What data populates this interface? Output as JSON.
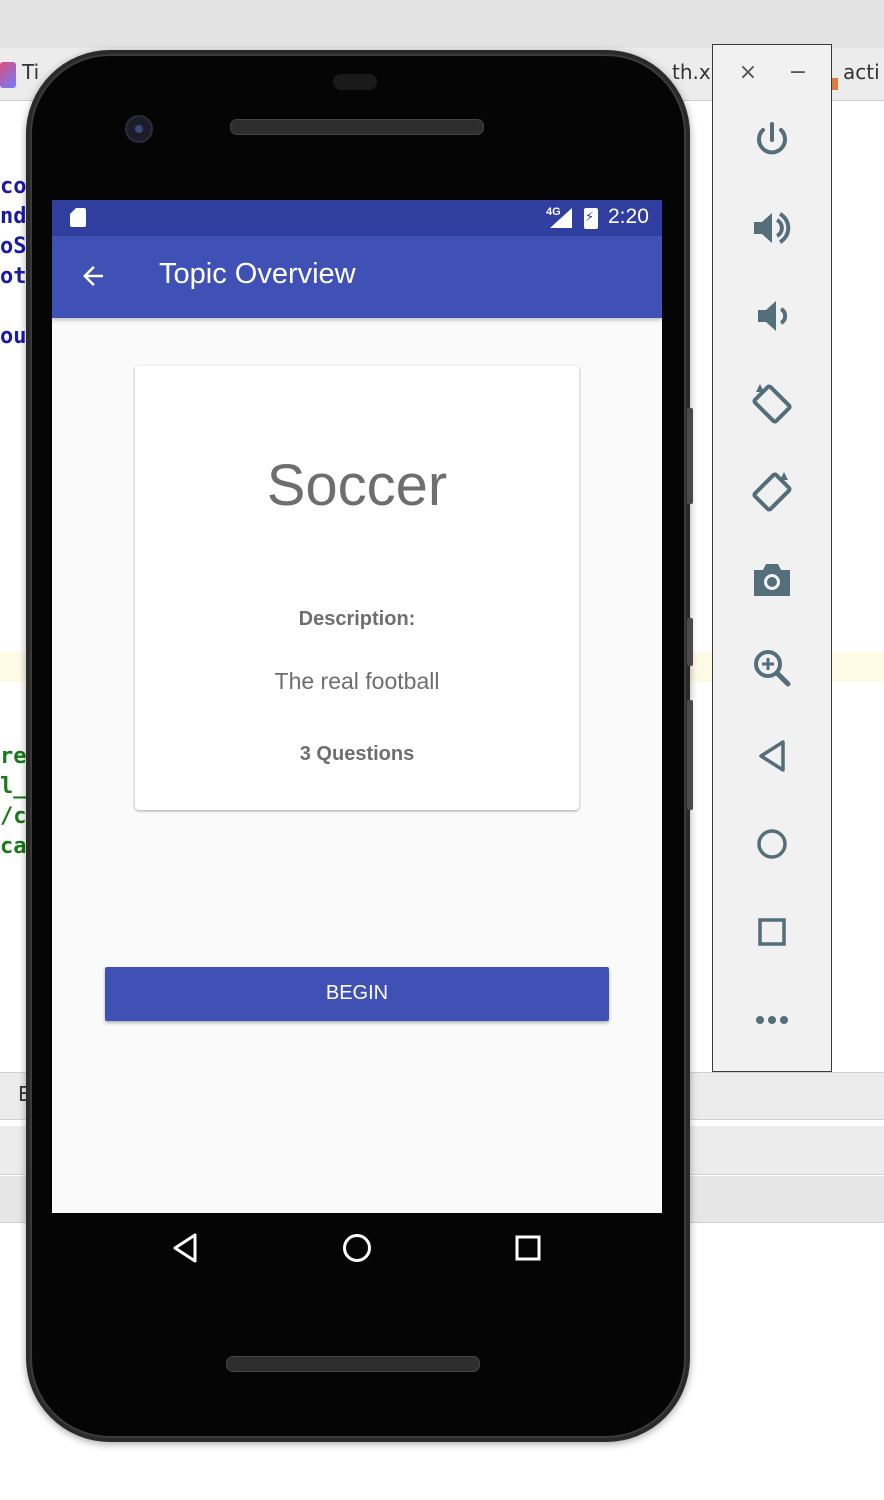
{
  "ide": {
    "tab_left": "Ti",
    "tab_middle": "th.x",
    "tab_right": "acti",
    "bottom_panel_letter": "E",
    "code_lines_blue": [
      "coB",
      "ndC",
      "oSt",
      "ott",
      "",
      "out"
    ],
    "code_lines_green": [
      "re",
      "l_v",
      "/ca",
      "ca"
    ]
  },
  "device": {
    "status_bar": {
      "network": "4G",
      "time": "2:20",
      "icons": [
        "sd-card-icon",
        "signal-icon",
        "battery-charging-icon"
      ]
    },
    "app_bar": {
      "title": "Topic Overview",
      "back_icon": "arrow-back-icon"
    },
    "topic": {
      "name": "Soccer",
      "description_label": "Description:",
      "description": "The real football",
      "question_count": "3 Questions"
    },
    "begin_button": "BEGIN",
    "nav_bar": [
      "back-triangle-icon",
      "home-circle-icon",
      "recents-square-icon"
    ]
  },
  "emulator_toolbar": {
    "window_controls": [
      "×",
      "−"
    ],
    "buttons": [
      "power-icon",
      "volume-up-icon",
      "volume-down-icon",
      "rotate-left-icon",
      "rotate-right-icon",
      "camera-icon",
      "zoom-in-icon",
      "back-icon",
      "home-icon",
      "overview-icon",
      "more-icon"
    ]
  },
  "colors": {
    "primary": "#3f51b5",
    "primary_dark": "#303f9f",
    "text_secondary": "#6e6e6e",
    "screen_bg": "#fafafa",
    "toolbar_icon": "#546e7a"
  }
}
